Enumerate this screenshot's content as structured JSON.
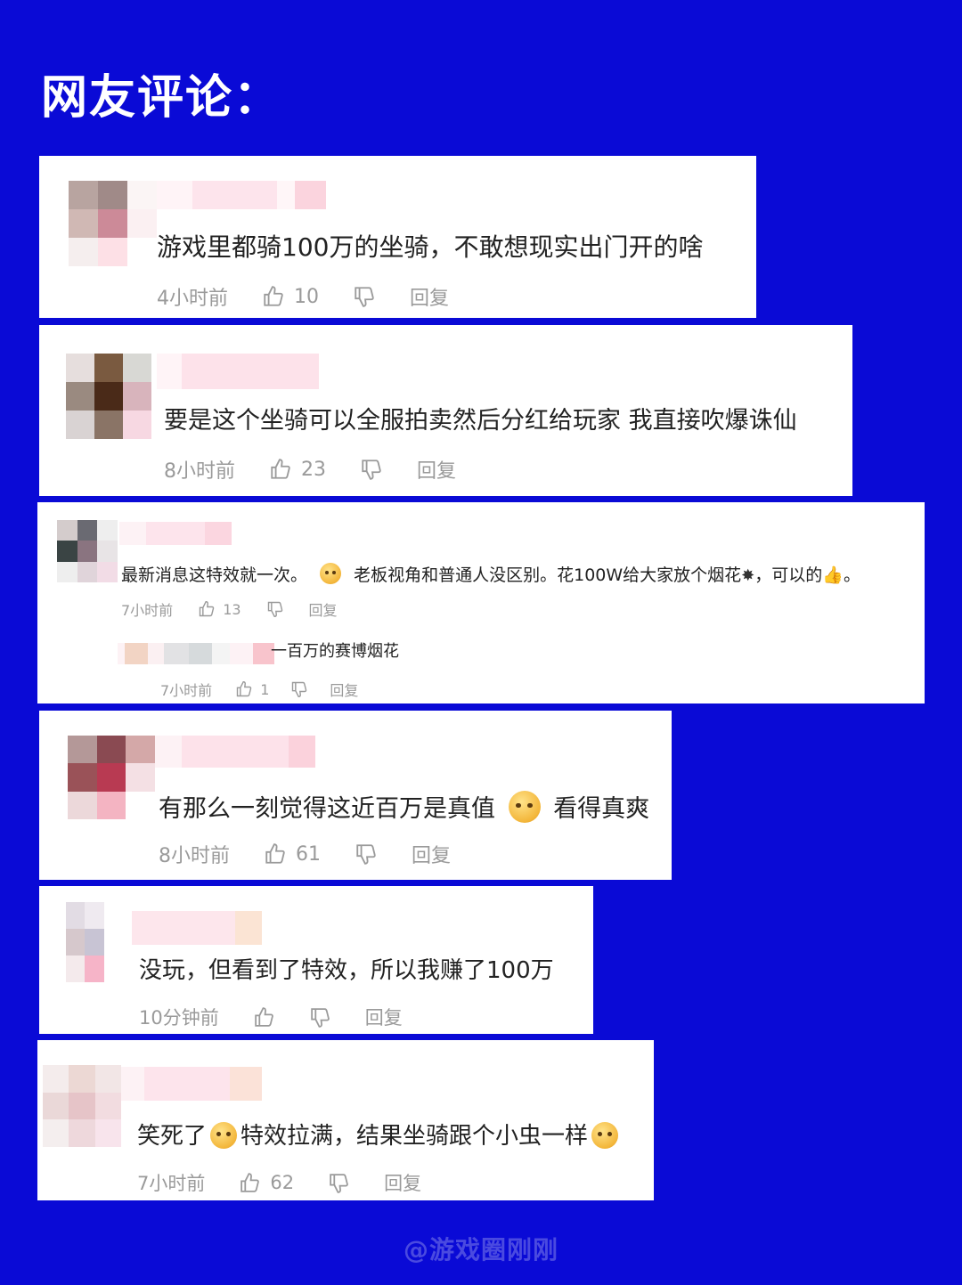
{
  "page": {
    "heading": "网友评论：",
    "watermark": "@游戏圈刚刚",
    "background": "#0a0ad6"
  },
  "comments": [
    {
      "text": "游戏里都骑100万的坐骑，不敢想现实出门开的啥",
      "time": "4小时前",
      "likes": "10",
      "reply_label": "回复"
    },
    {
      "text": "要是这个坐骑可以全服拍卖然后分红给玩家 我直接吹爆诛仙",
      "time": "8小时前",
      "likes": "23",
      "reply_label": "回复"
    },
    {
      "text_a": "最新消息这特效就一次。",
      "text_b": "老板视角和普通人没区别。花100W给大家放个烟花",
      "text_c": "，可以的",
      "text_d": "。",
      "time": "7小时前",
      "likes": "13",
      "reply_label": "回复",
      "sub_reply": {
        "text": "一百万的赛博烟花",
        "time": "7小时前",
        "likes": "1",
        "reply_label": "回复"
      }
    },
    {
      "text_a": "有那么一刻觉得这近百万是真值",
      "text_b": "看得真爽",
      "time": "8小时前",
      "likes": "61",
      "reply_label": "回复"
    },
    {
      "text": "没玩，但看到了特效，所以我赚了100万",
      "time": "10分钟前",
      "likes": "",
      "reply_label": "回复"
    },
    {
      "text_a": "笑死了",
      "text_b": "特效拉满，结果坐骑跟个小虫一样",
      "time": "7小时前",
      "likes": "62",
      "reply_label": "回复"
    }
  ],
  "icons": {
    "like": "thumbs-up-icon",
    "dislike": "thumbs-down-icon",
    "emoji": "emoji-face-icon",
    "firework": "firework-icon",
    "ok_hand": "thumbs-up-emoji-icon"
  }
}
